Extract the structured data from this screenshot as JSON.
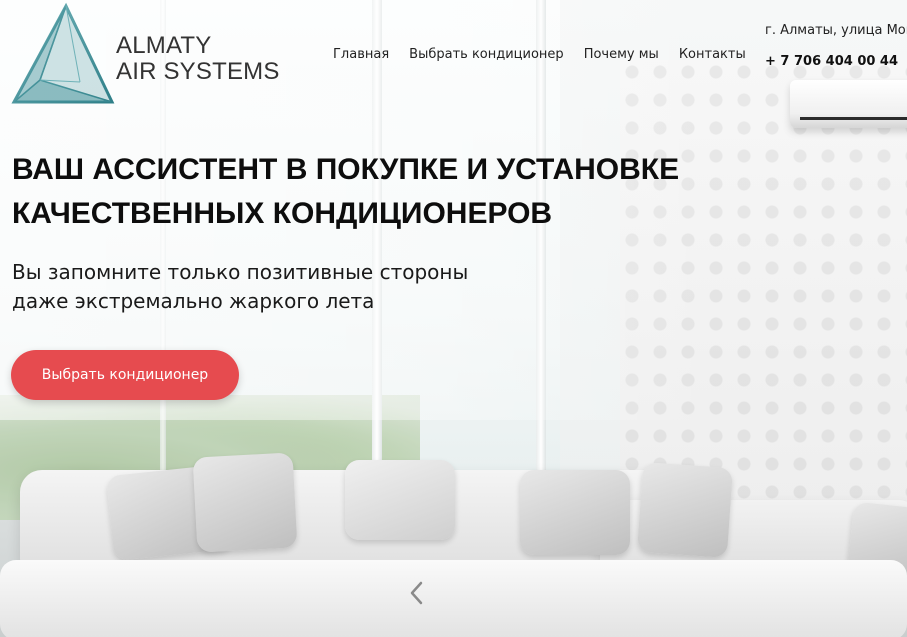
{
  "brand": {
    "line1": "ALMATY",
    "line2": "AIR SYSTEMS",
    "logo_icon": "triangle-logo-icon",
    "logo_color": "#3f8f97"
  },
  "nav": {
    "items": [
      {
        "label": "Главная"
      },
      {
        "label": "Выбрать кондиционер"
      },
      {
        "label": "Почему мы"
      },
      {
        "label": "Контакты"
      }
    ]
  },
  "contact": {
    "address": "г. Алматы, улица Монго",
    "phone": "+ 7 706 404 00 44"
  },
  "hero": {
    "title_line1": "ВАШ АССИСТЕНТ В ПОКУПКЕ И УСТАНОВКЕ",
    "title_line2": "КАЧЕСТВЕННЫХ КОНДИЦИОНЕРОВ",
    "subtitle_line1": "Вы запомните только позитивные стороны",
    "subtitle_line2": "даже экстремально жаркого лета",
    "cta_label": "Выбрать кондиционер",
    "cta_color": "#e64b4f"
  },
  "slider": {
    "prev_icon": "chevron-left-icon"
  }
}
